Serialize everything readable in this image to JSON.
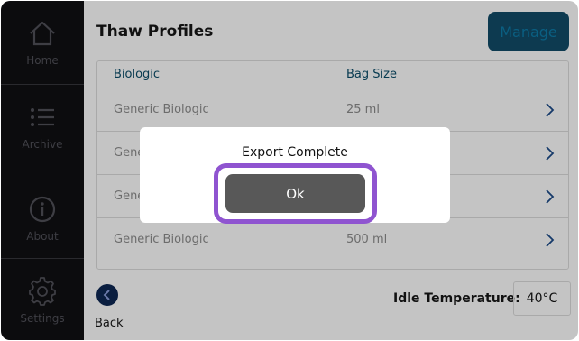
{
  "sidebar": {
    "items": [
      {
        "label": "Home",
        "icon": "home-icon"
      },
      {
        "label": "Archive",
        "icon": "list-icon"
      },
      {
        "label": "About",
        "icon": "info-icon"
      },
      {
        "label": "Settings",
        "icon": "gear-icon"
      }
    ]
  },
  "header": {
    "title": "Thaw Profiles",
    "manage_label": "Manage"
  },
  "table": {
    "columns": [
      "Biologic",
      "Bag Size"
    ],
    "rows": [
      {
        "biologic": "Generic Biologic",
        "bag_size": "25 ml"
      },
      {
        "biologic": "Gene",
        "bag_size": ""
      },
      {
        "biologic": "Gene",
        "bag_size": ""
      },
      {
        "biologic": "Generic Biologic",
        "bag_size": "500 ml"
      }
    ]
  },
  "footer": {
    "back_label": "Back",
    "idle_temperature_label": "Idle Temperature:",
    "idle_temperature_value": "40°C"
  },
  "dialog": {
    "title": "Export Complete",
    "ok_label": "Ok"
  },
  "colors": {
    "sidebar_bg": "#0c0c0e",
    "overlay_bg": "#c4c4c4",
    "manage_bg": "#0d3a50",
    "ok_button_bg": "#585858",
    "highlight": "#8f54d0"
  }
}
